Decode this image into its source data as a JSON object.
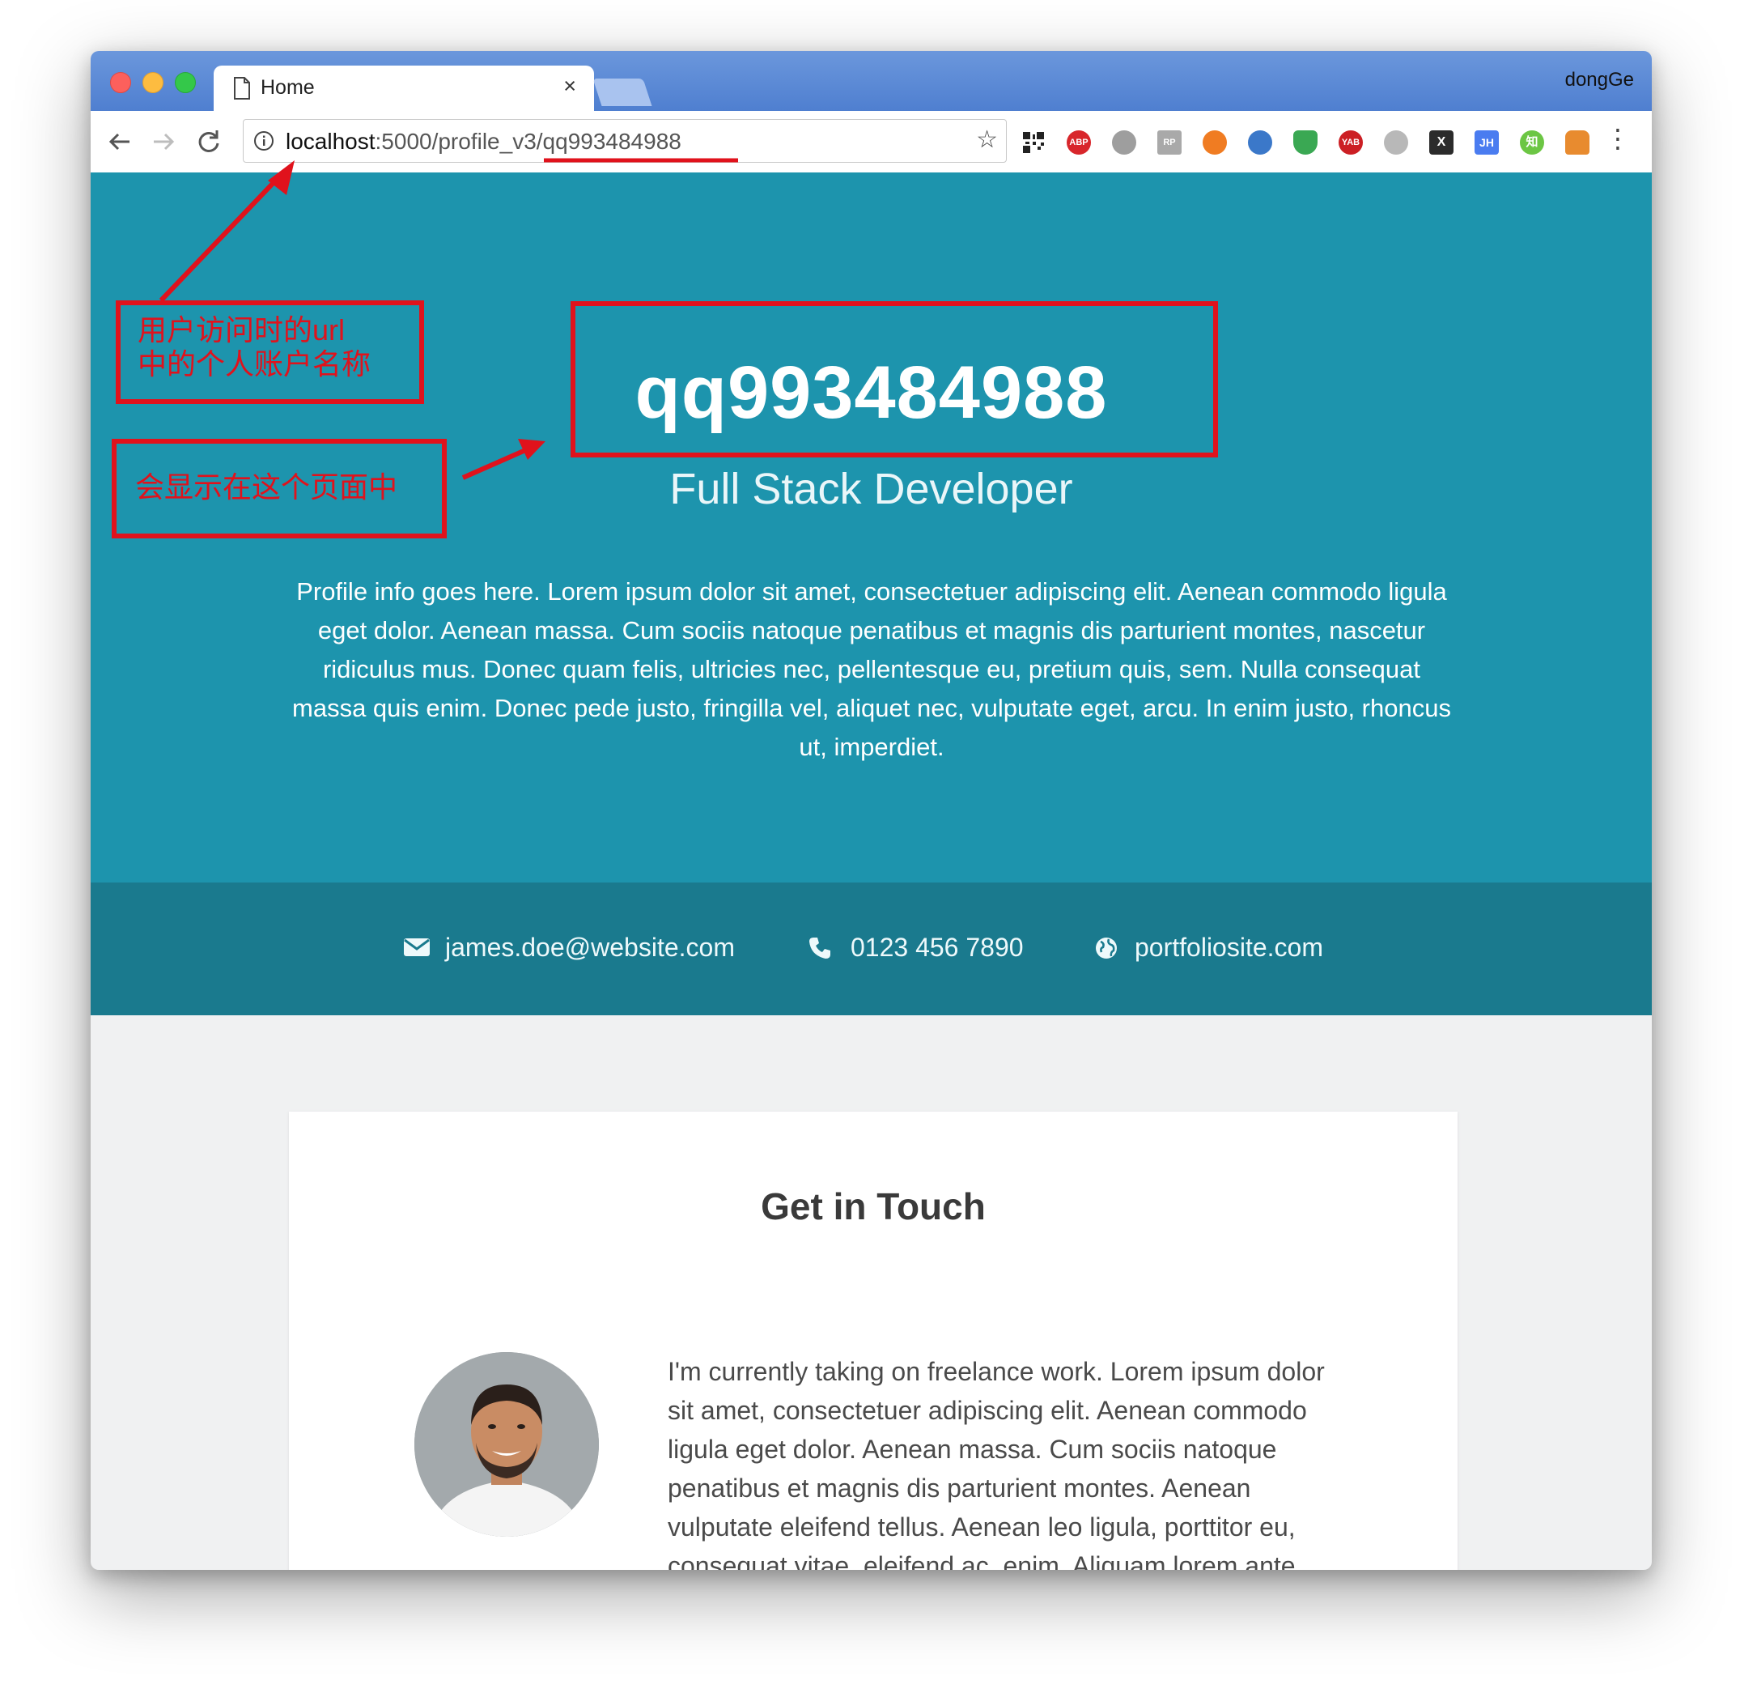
{
  "browser": {
    "tab_title": "Home",
    "tab_close": "×",
    "profile_name": "dongGe",
    "url_host": "localhost",
    "url_rest": ":5000/profile_v3/qq993484988",
    "star": "☆",
    "menu": "⋮",
    "extensions": [
      {
        "name": "qr-code-extension-icon",
        "label": ""
      },
      {
        "name": "adblock-plus-extension-icon",
        "label": "ABP"
      },
      {
        "name": "globe-extension-icon",
        "label": ""
      },
      {
        "name": "rp-extension-icon",
        "label": "RP"
      },
      {
        "name": "lifebuoy-extension-icon",
        "label": ""
      },
      {
        "name": "search-extension-icon",
        "label": ""
      },
      {
        "name": "shield-extension-icon",
        "label": ""
      },
      {
        "name": "yab-extension-icon",
        "label": "YAB"
      },
      {
        "name": "sphere-extension-icon",
        "label": ""
      },
      {
        "name": "x-extension-icon",
        "label": "X"
      },
      {
        "name": "jh-extension-icon",
        "label": "JH"
      },
      {
        "name": "zhihu-extension-icon",
        "label": "知"
      },
      {
        "name": "fox-extension-icon",
        "label": ""
      }
    ]
  },
  "hero": {
    "name": "qq993484988",
    "title": "Full Stack Developer",
    "description": "Profile info goes here. Lorem ipsum dolor sit amet, consectetuer adipiscing elit. Aenean commodo ligula eget dolor. Aenean massa. Cum sociis natoque penatibus et magnis dis parturient montes, nascetur ridiculus mus. Donec quam felis, ultricies nec, pellentesque eu, pretium quis, sem. Nulla consequat massa quis enim. Donec pede justo, fringilla vel, aliquet nec, vulputate eget, arcu. In enim justo, rhoncus ut, imperdiet."
  },
  "contact": {
    "email": "james.doe@website.com",
    "phone": "0123 456 7890",
    "website": "portfoliosite.com"
  },
  "section": {
    "title": "Get in Touch",
    "text": "I'm currently taking on freelance work. Lorem ipsum dolor sit amet, consectetuer adipiscing elit. Aenean commodo ligula eget dolor. Aenean massa. Cum sociis natoque penatibus et magnis dis parturient montes. Aenean vulputate eleifend tellus. Aenean leo ligula, porttitor eu, consequat vitae, eleifend ac, enim. Aliquam lorem ante,"
  },
  "annotations": {
    "url_note_line1": "用户访问时的url",
    "url_note_line2": "中的个人账户名称",
    "display_note": "会显示在这个页面中"
  },
  "colors": {
    "hero_bg": "#1d94ad",
    "contact_bg": "#1a7a8e",
    "annotation_red": "#e0121c",
    "titlebar_blue": "#5b88d6"
  }
}
